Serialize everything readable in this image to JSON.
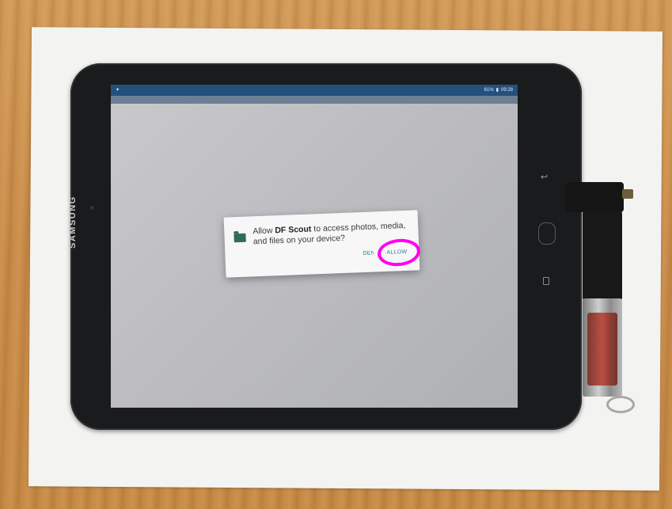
{
  "device": {
    "brand": "SAMSUNG",
    "status_bar": {
      "battery": "61%",
      "time": "09:28"
    }
  },
  "dialog": {
    "message_prefix": "Allow ",
    "app_name": "DF Scout",
    "message_suffix": " to access photos, media, and files on your device?",
    "deny_label": "DENY",
    "allow_label": "ALLOW"
  },
  "annotation": {
    "highlight_color": "#ff00f0",
    "highlight_target": "ALLOW"
  }
}
